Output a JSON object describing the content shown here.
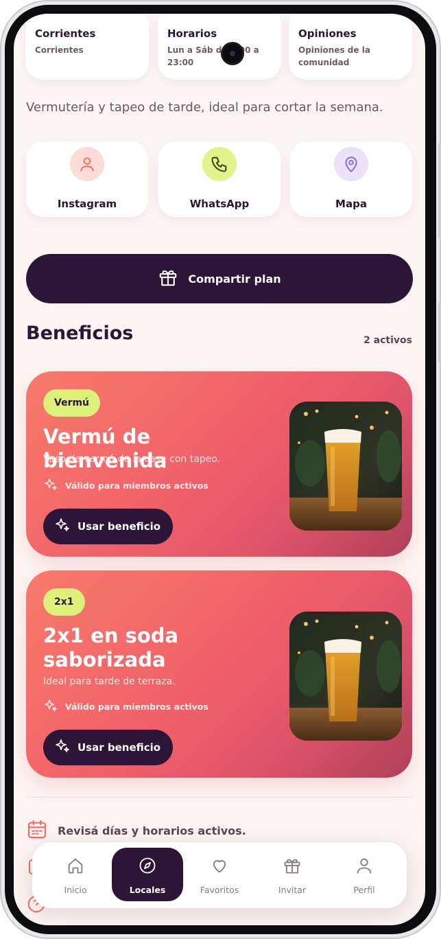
{
  "info_cards": [
    {
      "title": "Corrientes",
      "sub": "Corrientes"
    },
    {
      "title": "Horarios",
      "sub": "Lun a Sáb de 8:00 a 23:00"
    },
    {
      "title": "Opiniones",
      "sub": "Opiniones de la comunidad"
    }
  ],
  "tagline": "Vermutería y tapeo de tarde, ideal para cortar la semana.",
  "contacts": [
    {
      "label": "Instagram",
      "icon": "user-icon",
      "color": "#f56c5f",
      "bg": "#fdddd6"
    },
    {
      "label": "WhatsApp",
      "icon": "phone-icon",
      "color": "#3f4a12",
      "bg": "#e2f38b"
    },
    {
      "label": "Mapa",
      "icon": "map-pin-icon",
      "color": "#8a66d8",
      "bg": "#ece3fb"
    }
  ],
  "share": {
    "label": "Compartir plan",
    "icon": "gift-icon"
  },
  "benefits_section": {
    "title": "Beneficios",
    "count": "2 activos"
  },
  "benefits": [
    {
      "badge": "Vermú",
      "title": "Vermú de bienvenida",
      "desc": "Vaso de vermú de la casa con tapeo.",
      "valid": "Válido para miembros activos",
      "button": "Usar beneficio"
    },
    {
      "badge": "2x1",
      "title": "2x1 en soda saborizada",
      "desc": "Ideal para tarde de terraza.",
      "valid": "Válido para miembros activos",
      "button": "Usar beneficio"
    }
  ],
  "info_rows": [
    {
      "text": "Revisá días y horarios activos.",
      "icon": "calendar-icon"
    }
  ],
  "nav": [
    {
      "label": "Inicio",
      "icon": "home-icon",
      "active": false
    },
    {
      "label": "Locales",
      "icon": "compass-icon",
      "active": true
    },
    {
      "label": "Favoritos",
      "icon": "heart-icon",
      "active": false
    },
    {
      "label": "Invitar",
      "icon": "gift-icon",
      "active": false
    },
    {
      "label": "Perfil",
      "icon": "user-icon",
      "active": false
    }
  ],
  "colors": {
    "accent_dark": "#2c1536",
    "lime": "#dcf07a",
    "coral": "#f0606a"
  }
}
